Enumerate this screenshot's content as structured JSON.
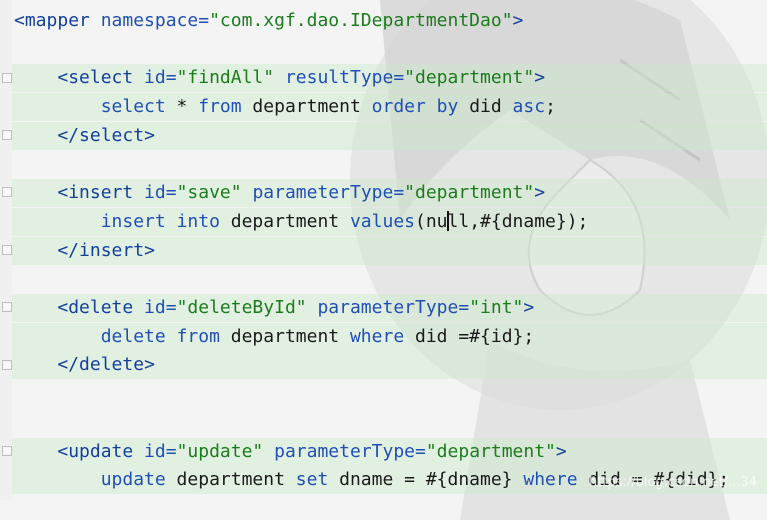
{
  "editor": {
    "lines": [
      [
        {
          "t": "<",
          "c": "tag"
        },
        {
          "t": "mapper",
          "c": "tag"
        },
        {
          "t": " namespace=",
          "c": "attr"
        },
        {
          "t": "\"com.xgf.dao.IDepartmentDao\"",
          "c": "str"
        },
        {
          "t": ">",
          "c": "tag"
        }
      ],
      [],
      [
        {
          "t": "    <",
          "c": "tag"
        },
        {
          "t": "select",
          "c": "tag"
        },
        {
          "t": " id=",
          "c": "attr"
        },
        {
          "t": "\"findAll\"",
          "c": "str"
        },
        {
          "t": " resultType=",
          "c": "attr"
        },
        {
          "t": "\"department\"",
          "c": "str"
        },
        {
          "t": ">",
          "c": "tag"
        }
      ],
      [
        {
          "t": "        select",
          "c": "kw"
        },
        {
          "t": " * ",
          "c": "pl"
        },
        {
          "t": "from",
          "c": "kw"
        },
        {
          "t": " department ",
          "c": "pl"
        },
        {
          "t": "order",
          "c": "kw"
        },
        {
          "t": " ",
          "c": "pl"
        },
        {
          "t": "by",
          "c": "kw"
        },
        {
          "t": " did ",
          "c": "pl"
        },
        {
          "t": "asc",
          "c": "kw"
        },
        {
          "t": ";",
          "c": "pl"
        }
      ],
      [
        {
          "t": "    </",
          "c": "tag"
        },
        {
          "t": "select",
          "c": "tag"
        },
        {
          "t": ">",
          "c": "tag"
        }
      ],
      [],
      [
        {
          "t": "    <",
          "c": "tag"
        },
        {
          "t": "insert",
          "c": "tag"
        },
        {
          "t": " id=",
          "c": "attr"
        },
        {
          "t": "\"save\"",
          "c": "str"
        },
        {
          "t": " parameterType=",
          "c": "attr"
        },
        {
          "t": "\"department\"",
          "c": "str"
        },
        {
          "t": ">",
          "c": "tag"
        }
      ],
      [
        {
          "t": "        insert",
          "c": "kw"
        },
        {
          "t": " ",
          "c": "pl"
        },
        {
          "t": "into",
          "c": "kw"
        },
        {
          "t": " department ",
          "c": "pl"
        },
        {
          "t": "values",
          "c": "kw"
        },
        {
          "t": "(nu",
          "c": "pl"
        },
        {
          "t": "",
          "c": "caret"
        },
        {
          "t": "ll,#{dname});",
          "c": "pl"
        }
      ],
      [
        {
          "t": "    </",
          "c": "tag"
        },
        {
          "t": "insert",
          "c": "tag"
        },
        {
          "t": ">",
          "c": "tag"
        }
      ],
      [],
      [
        {
          "t": "    <",
          "c": "tag"
        },
        {
          "t": "delete",
          "c": "tag"
        },
        {
          "t": " id=",
          "c": "attr"
        },
        {
          "t": "\"deleteById\"",
          "c": "str"
        },
        {
          "t": " parameterType=",
          "c": "attr"
        },
        {
          "t": "\"int\"",
          "c": "str"
        },
        {
          "t": ">",
          "c": "tag"
        }
      ],
      [
        {
          "t": "        delete",
          "c": "kw"
        },
        {
          "t": " ",
          "c": "pl"
        },
        {
          "t": "from",
          "c": "kw"
        },
        {
          "t": " department ",
          "c": "pl"
        },
        {
          "t": "where",
          "c": "kw"
        },
        {
          "t": " did =#{id};",
          "c": "pl"
        }
      ],
      [
        {
          "t": "    </",
          "c": "tag"
        },
        {
          "t": "delete",
          "c": "tag"
        },
        {
          "t": ">",
          "c": "tag"
        }
      ],
      [],
      [],
      [
        {
          "t": "    <",
          "c": "tag"
        },
        {
          "t": "update",
          "c": "tag"
        },
        {
          "t": " id=",
          "c": "attr"
        },
        {
          "t": "\"update\"",
          "c": "str"
        },
        {
          "t": " parameterType=",
          "c": "attr"
        },
        {
          "t": "\"department\"",
          "c": "str"
        },
        {
          "t": ">",
          "c": "tag"
        }
      ],
      [
        {
          "t": "        update",
          "c": "kw"
        },
        {
          "t": " department ",
          "c": "pl"
        },
        {
          "t": "set",
          "c": "kw"
        },
        {
          "t": " dname = #{dname} ",
          "c": "pl"
        },
        {
          "t": "where",
          "c": "kw"
        },
        {
          "t": " did = #{did};",
          "c": "pl"
        }
      ]
    ],
    "highlighted_lines": [
      2,
      3,
      4,
      6,
      7,
      8,
      10,
      11,
      12,
      15,
      16
    ],
    "colors": {
      "tag": "#123f9c",
      "attribute": "#1f4fb4",
      "string": "#1b7c1b",
      "keyword": "#1f4fb4",
      "highlight": "#cdebcd"
    }
  },
  "watermark": "https://blog.csdn.net/...34"
}
